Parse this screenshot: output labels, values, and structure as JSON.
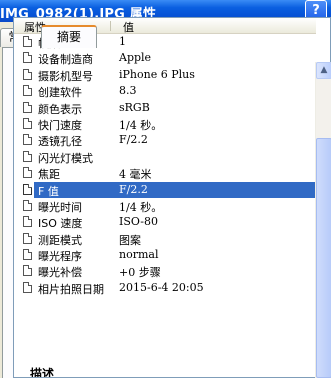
{
  "window": {
    "title": "IMG_0982(1).JPG 属性",
    "help_button": "?"
  },
  "tabs": [
    {
      "label": "常规",
      "active": false
    },
    {
      "label": "摘要",
      "active": true
    }
  ],
  "table": {
    "headers": [
      "属性",
      "值"
    ],
    "rows": [
      {
        "name": "帧数",
        "value": "1"
      },
      {
        "name": "设备制造商",
        "value": "Apple"
      },
      {
        "name": "摄影机型号",
        "value": "iPhone 6 Plus"
      },
      {
        "name": "创建软件",
        "value": "8.3"
      },
      {
        "name": "颜色表示",
        "value": "sRGB"
      },
      {
        "name": "快门速度",
        "value": "1/4 秒。"
      },
      {
        "name": "透镜孔径",
        "value": "F/2.2"
      },
      {
        "name": "闪光灯模式",
        "value": ""
      },
      {
        "name": "焦距",
        "value": "4 毫米"
      },
      {
        "name": "F 值",
        "value": "F/2.2",
        "selected": true
      },
      {
        "name": "曝光时间",
        "value": "1/4 秒。"
      },
      {
        "name": "ISO 速度",
        "value": "ISO-80"
      },
      {
        "name": "测距模式",
        "value": "图案"
      },
      {
        "name": "曝光程序",
        "value": "normal"
      },
      {
        "name": "曝光补偿",
        "value": "+0 步骤"
      },
      {
        "name": "相片拍照日期",
        "value": "2015-6-4 20:05"
      }
    ]
  },
  "section_label": "描述",
  "colors": {
    "title_bar": "#0652d6",
    "selection": "#316ac5",
    "tab_accent": "#e68b2c"
  }
}
